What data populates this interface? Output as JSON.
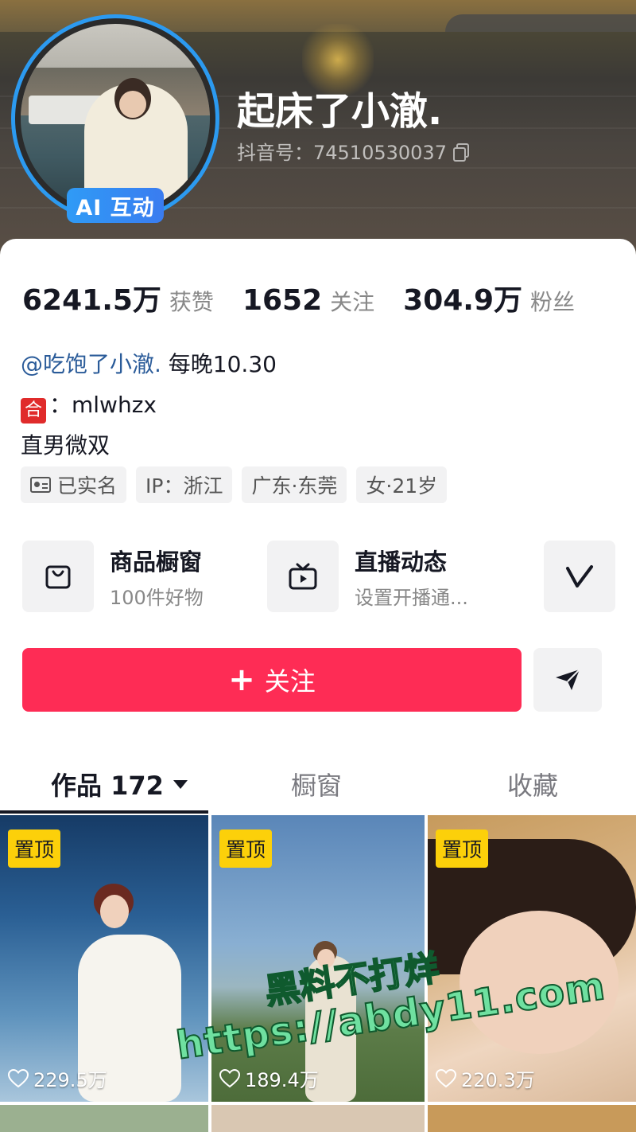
{
  "profile": {
    "nickname": "起床了小澈.",
    "douyin_id": "抖音号：74510530037",
    "ai_badge": "AI 互动"
  },
  "stats": [
    {
      "value": "6241.5万",
      "label": "获赞"
    },
    {
      "value": "1652",
      "label": "关注"
    },
    {
      "value": "304.9万",
      "label": "粉丝"
    }
  ],
  "bio": {
    "mention": "@吃饱了小澈.",
    "line1_rest": " 每晚10.30",
    "badge": "合",
    "line2_rest": "：mlwhzx",
    "line3": "直男微双"
  },
  "tags": [
    "已实名",
    "IP：浙江",
    "广东·东莞",
    "女·21岁"
  ],
  "services": [
    {
      "title": "商品橱窗",
      "subtitle": "100件好物",
      "icon": "shopping-bag-icon"
    },
    {
      "title": "直播动态",
      "subtitle": "设置开播通...",
      "icon": "tv-icon"
    },
    {
      "title": "",
      "subtitle": "",
      "icon": "v-logo-icon"
    }
  ],
  "actions": {
    "follow_label": "关注",
    "share_icon": "paper-plane-icon"
  },
  "tabs": [
    {
      "label": "作品 172",
      "active": true
    },
    {
      "label": "橱窗",
      "active": false
    },
    {
      "label": "收藏",
      "active": false
    }
  ],
  "videos": [
    {
      "pin": "置顶",
      "likes": "229.5万"
    },
    {
      "pin": "置顶",
      "likes": "189.4万"
    },
    {
      "pin": "置顶",
      "likes": "220.3万"
    }
  ],
  "watermark": {
    "line1": "黑料不打烊",
    "line2": "https://abdy11.com"
  },
  "colors": {
    "accent": "#fe2c55",
    "avatar_ring": "#2c9af0",
    "pin_badge": "#fcd00a",
    "mention": "#2a5b99"
  }
}
